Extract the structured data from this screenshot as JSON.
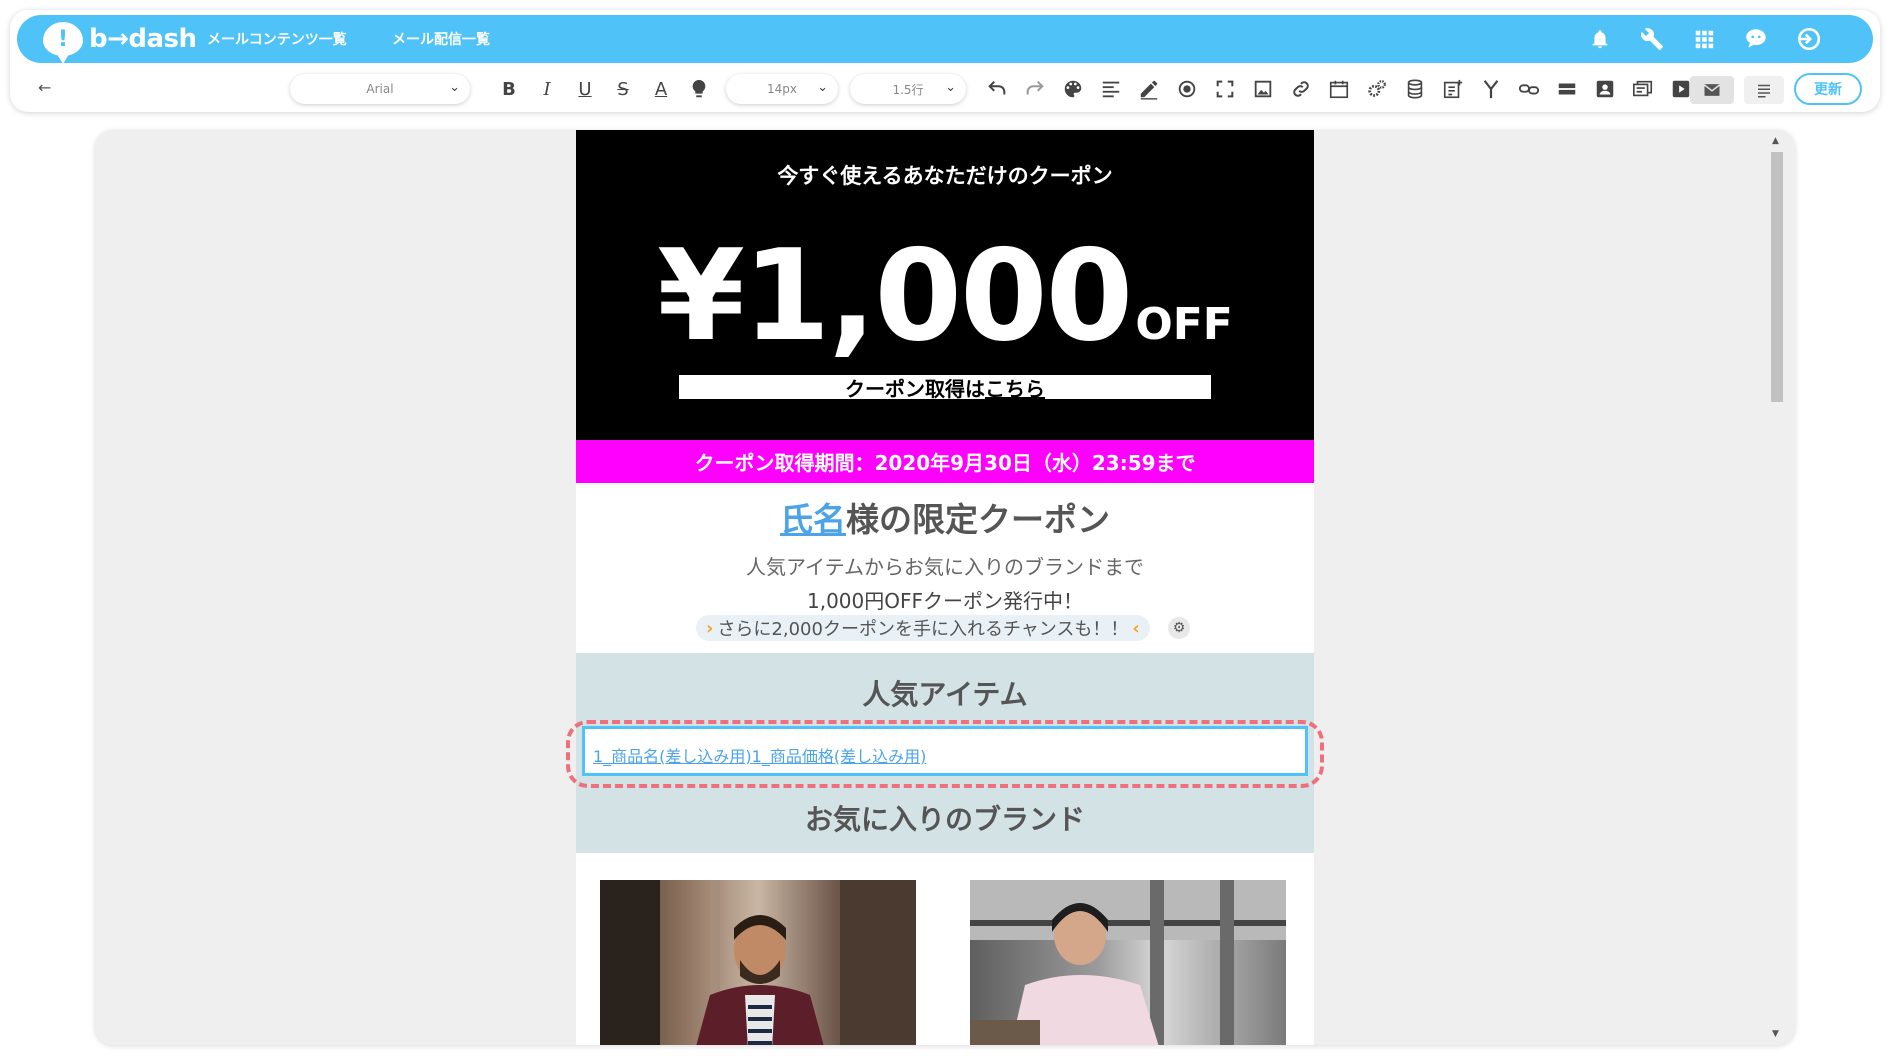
{
  "app": {
    "logo_mark": "!",
    "logo_text": "b→dash",
    "nav": [
      "メールコンテンツ一覧",
      "メール配信一覧"
    ]
  },
  "topbar_icons": [
    "bell-icon",
    "wrench-icon",
    "grid-icon",
    "support-icon",
    "logout-icon"
  ],
  "toolbar": {
    "back": "←",
    "font_family": "Arial",
    "font_size": "14px",
    "line_height": "1.5行",
    "update_label": "更新",
    "icons": [
      "bold-icon",
      "italic-icon",
      "underline-icon",
      "strikethrough-icon",
      "font-color-icon",
      "highlight-icon",
      "undo-icon",
      "redo-icon",
      "palette-icon",
      "align-icon",
      "pen-icon",
      "target-icon",
      "fullscreen-icon",
      "image-icon",
      "link-icon",
      "calendar-icon",
      "gears-icon",
      "database-icon",
      "note-icon",
      "branch-icon",
      "chain-icon",
      "hr-icon",
      "contact-icon",
      "cards-icon",
      "video-icon",
      "mail-icon",
      "text-align-icon"
    ]
  },
  "email": {
    "hero_title": "今すぐ使えるあなただけのクーポン",
    "price": "¥1,000",
    "price_suffix": "OFF",
    "cta_text": "クーポン取得は",
    "cta_link": "こちら",
    "period": "クーポン取得期間：2020年9月30日（水）23:59まで",
    "offer_name": "氏名",
    "offer_title_rest": "様の限定クーポン",
    "offer_line1": "人気アイテムからお気に入りのブランドまで",
    "offer_line2": "1,000円OFFクーポン発行中！",
    "chance_arrow_left": "›",
    "chance_text": "さらに2,000クーポンを手に入れるチャンスも！！",
    "chance_arrow_right": "‹",
    "popular_title": "人気アイテム",
    "product_link": "1_商品名(差し込み用)1_商品価格(差し込み用)",
    "brand_title": "お気に入りのブランド"
  },
  "colors": {
    "brand": "#4fc3f7",
    "period_bg": "#ff00ff",
    "section_bg": "#d3e2e5",
    "highlight_dash": "#ef6f7c",
    "link": "#4da3e8"
  }
}
